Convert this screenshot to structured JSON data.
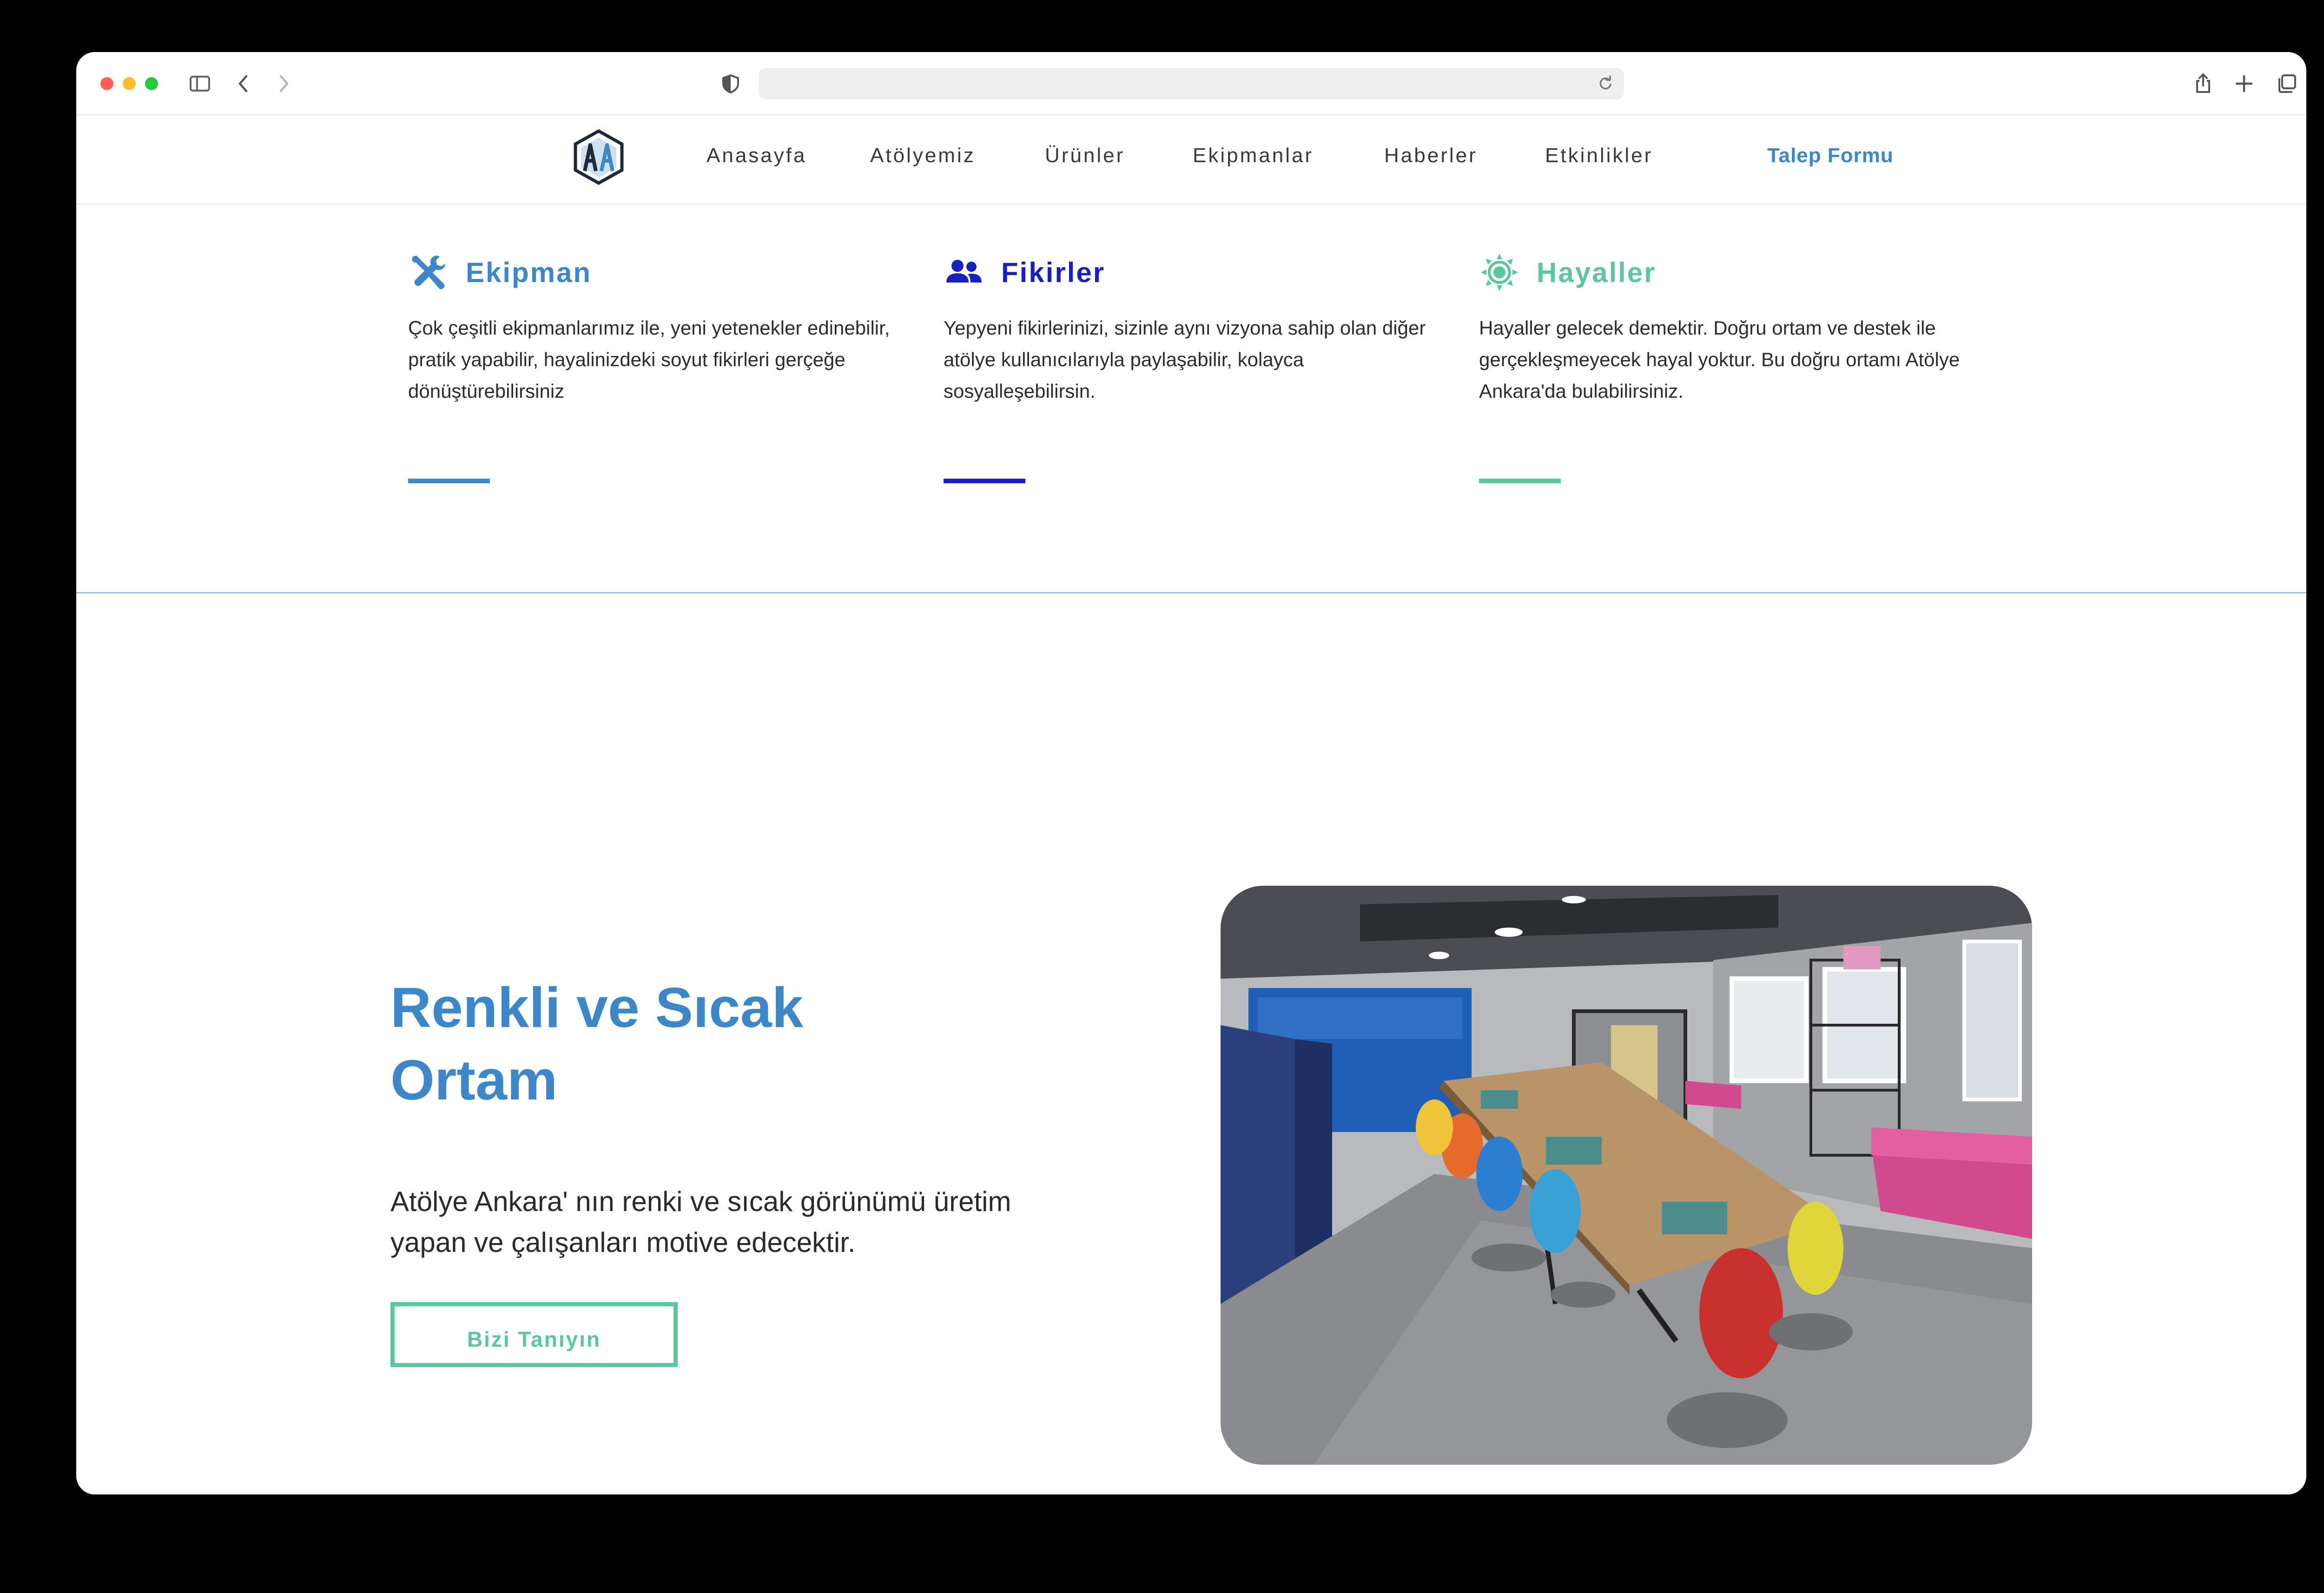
{
  "browser": {
    "url": "",
    "icons": [
      "sidebar-icon",
      "back-icon",
      "forward-icon",
      "shield-icon",
      "reload-icon",
      "share-icon",
      "new-tab-icon",
      "tabs-overview-icon"
    ]
  },
  "nav": {
    "logo": "AA",
    "items": [
      "Anasayfa",
      "Atölyemiz",
      "Ürünler",
      "Ekipmanlar",
      "Haberler",
      "Etkinlikler"
    ],
    "cta": "Talep Formu"
  },
  "features": [
    {
      "icon": "tools-icon",
      "title": "Ekipman",
      "text": "Çok çeşitli ekipmanlarımız ile, yeni yetenekler edinebilir, pratik yapabilir, hayalinizdeki soyut fikirleri gerçeğe dönüştürebilirsiniz",
      "color": "#3d87c9"
    },
    {
      "icon": "users-icon",
      "title": "Fikirler",
      "text": "Yepyeni fikirlerinizi, sizinle aynı vizyona sahip olan diğer atölye kullanıcılarıyla paylaşabilir, kolayca sosyalleşebilirsin.",
      "color": "#1a1fbf"
    },
    {
      "icon": "sun-icon",
      "title": "Hayaller",
      "text": "Hayaller gelecek demektir. Doğru ortam ve destek ile gerçekleşmeyecek hayal yoktur. Bu doğru ortamı Atölye Ankara'da bulabilirsiniz.",
      "color": "#5cc79a"
    }
  ],
  "hero": {
    "title_line1": "Renkli ve Sıcak",
    "title_line2": "Ortam",
    "text": "Atölye Ankara' nın renki ve sıcak görünümü üretim yapan ve çalışanları motive edecektir.",
    "button": "Bizi Tanıyın",
    "photo": "workshop-interior-photo"
  }
}
